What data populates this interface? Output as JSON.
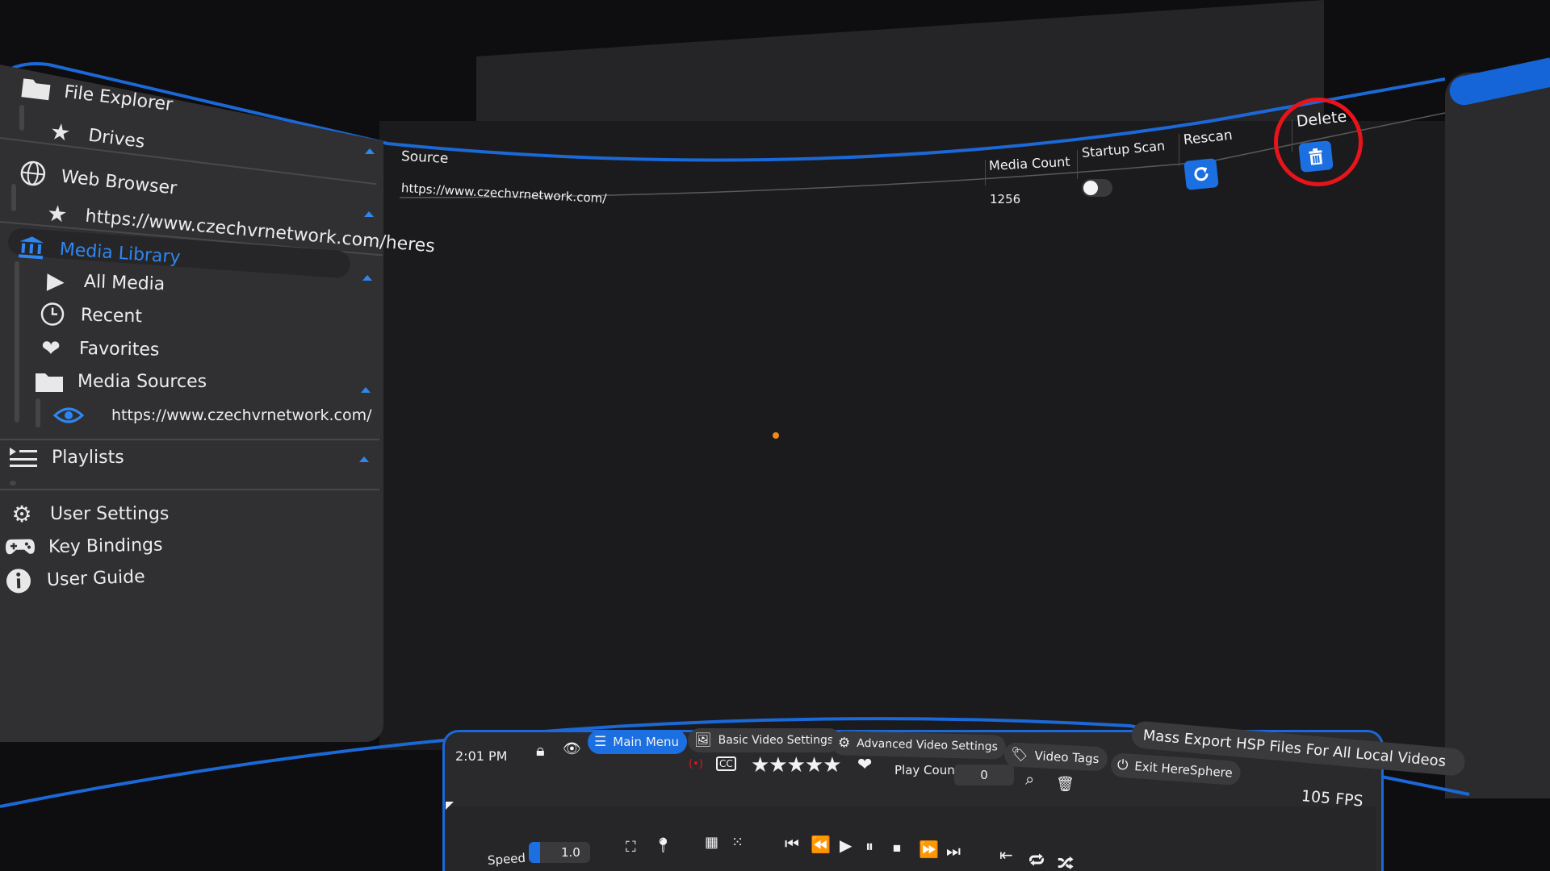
{
  "sidebar": {
    "file_explorer": "File Explorer",
    "drives": "Drives",
    "web_browser": "Web Browser",
    "web_url": "https://www.czechvrnetwork.com/heres",
    "media_library": "Media Library",
    "all_media": "All Media",
    "recent": "Recent",
    "favorites": "Favorites",
    "media_sources": "Media Sources",
    "source_url": "https://www.czechvrnetwork.com/",
    "playlists": "Playlists",
    "user_settings": "User Settings",
    "key_bindings": "Key Bindings",
    "user_guide": "User Guide"
  },
  "table": {
    "headers": {
      "source": "Source",
      "media_count": "Media Count",
      "startup_scan": "Startup Scan",
      "rescan": "Rescan",
      "delete": "Delete"
    },
    "rows": [
      {
        "source": "https://www.czechvrnetwork.com/",
        "media_count": "1256",
        "startup_scan": false
      }
    ]
  },
  "controller": {
    "time": "2:01 PM",
    "tabs": {
      "main_menu": "Main Menu",
      "basic_video_settings": "Basic Video Settings",
      "advanced_video_settings": "Advanced Video Settings",
      "video_tags": "Video Tags",
      "exit": "Exit HereSphere"
    },
    "play_count_label": "Play Count",
    "play_count_value": "0",
    "mass_export": "Mass Export HSP Files For All Local Videos",
    "fps": "105 FPS",
    "speed_label": "Speed",
    "speed_value": "1.0",
    "rating_stars": 5
  },
  "colors": {
    "accent": "#1c6fe0",
    "accent_text": "#2f86f0",
    "highlight": "#e8141b",
    "cursor": "#f08a16"
  }
}
